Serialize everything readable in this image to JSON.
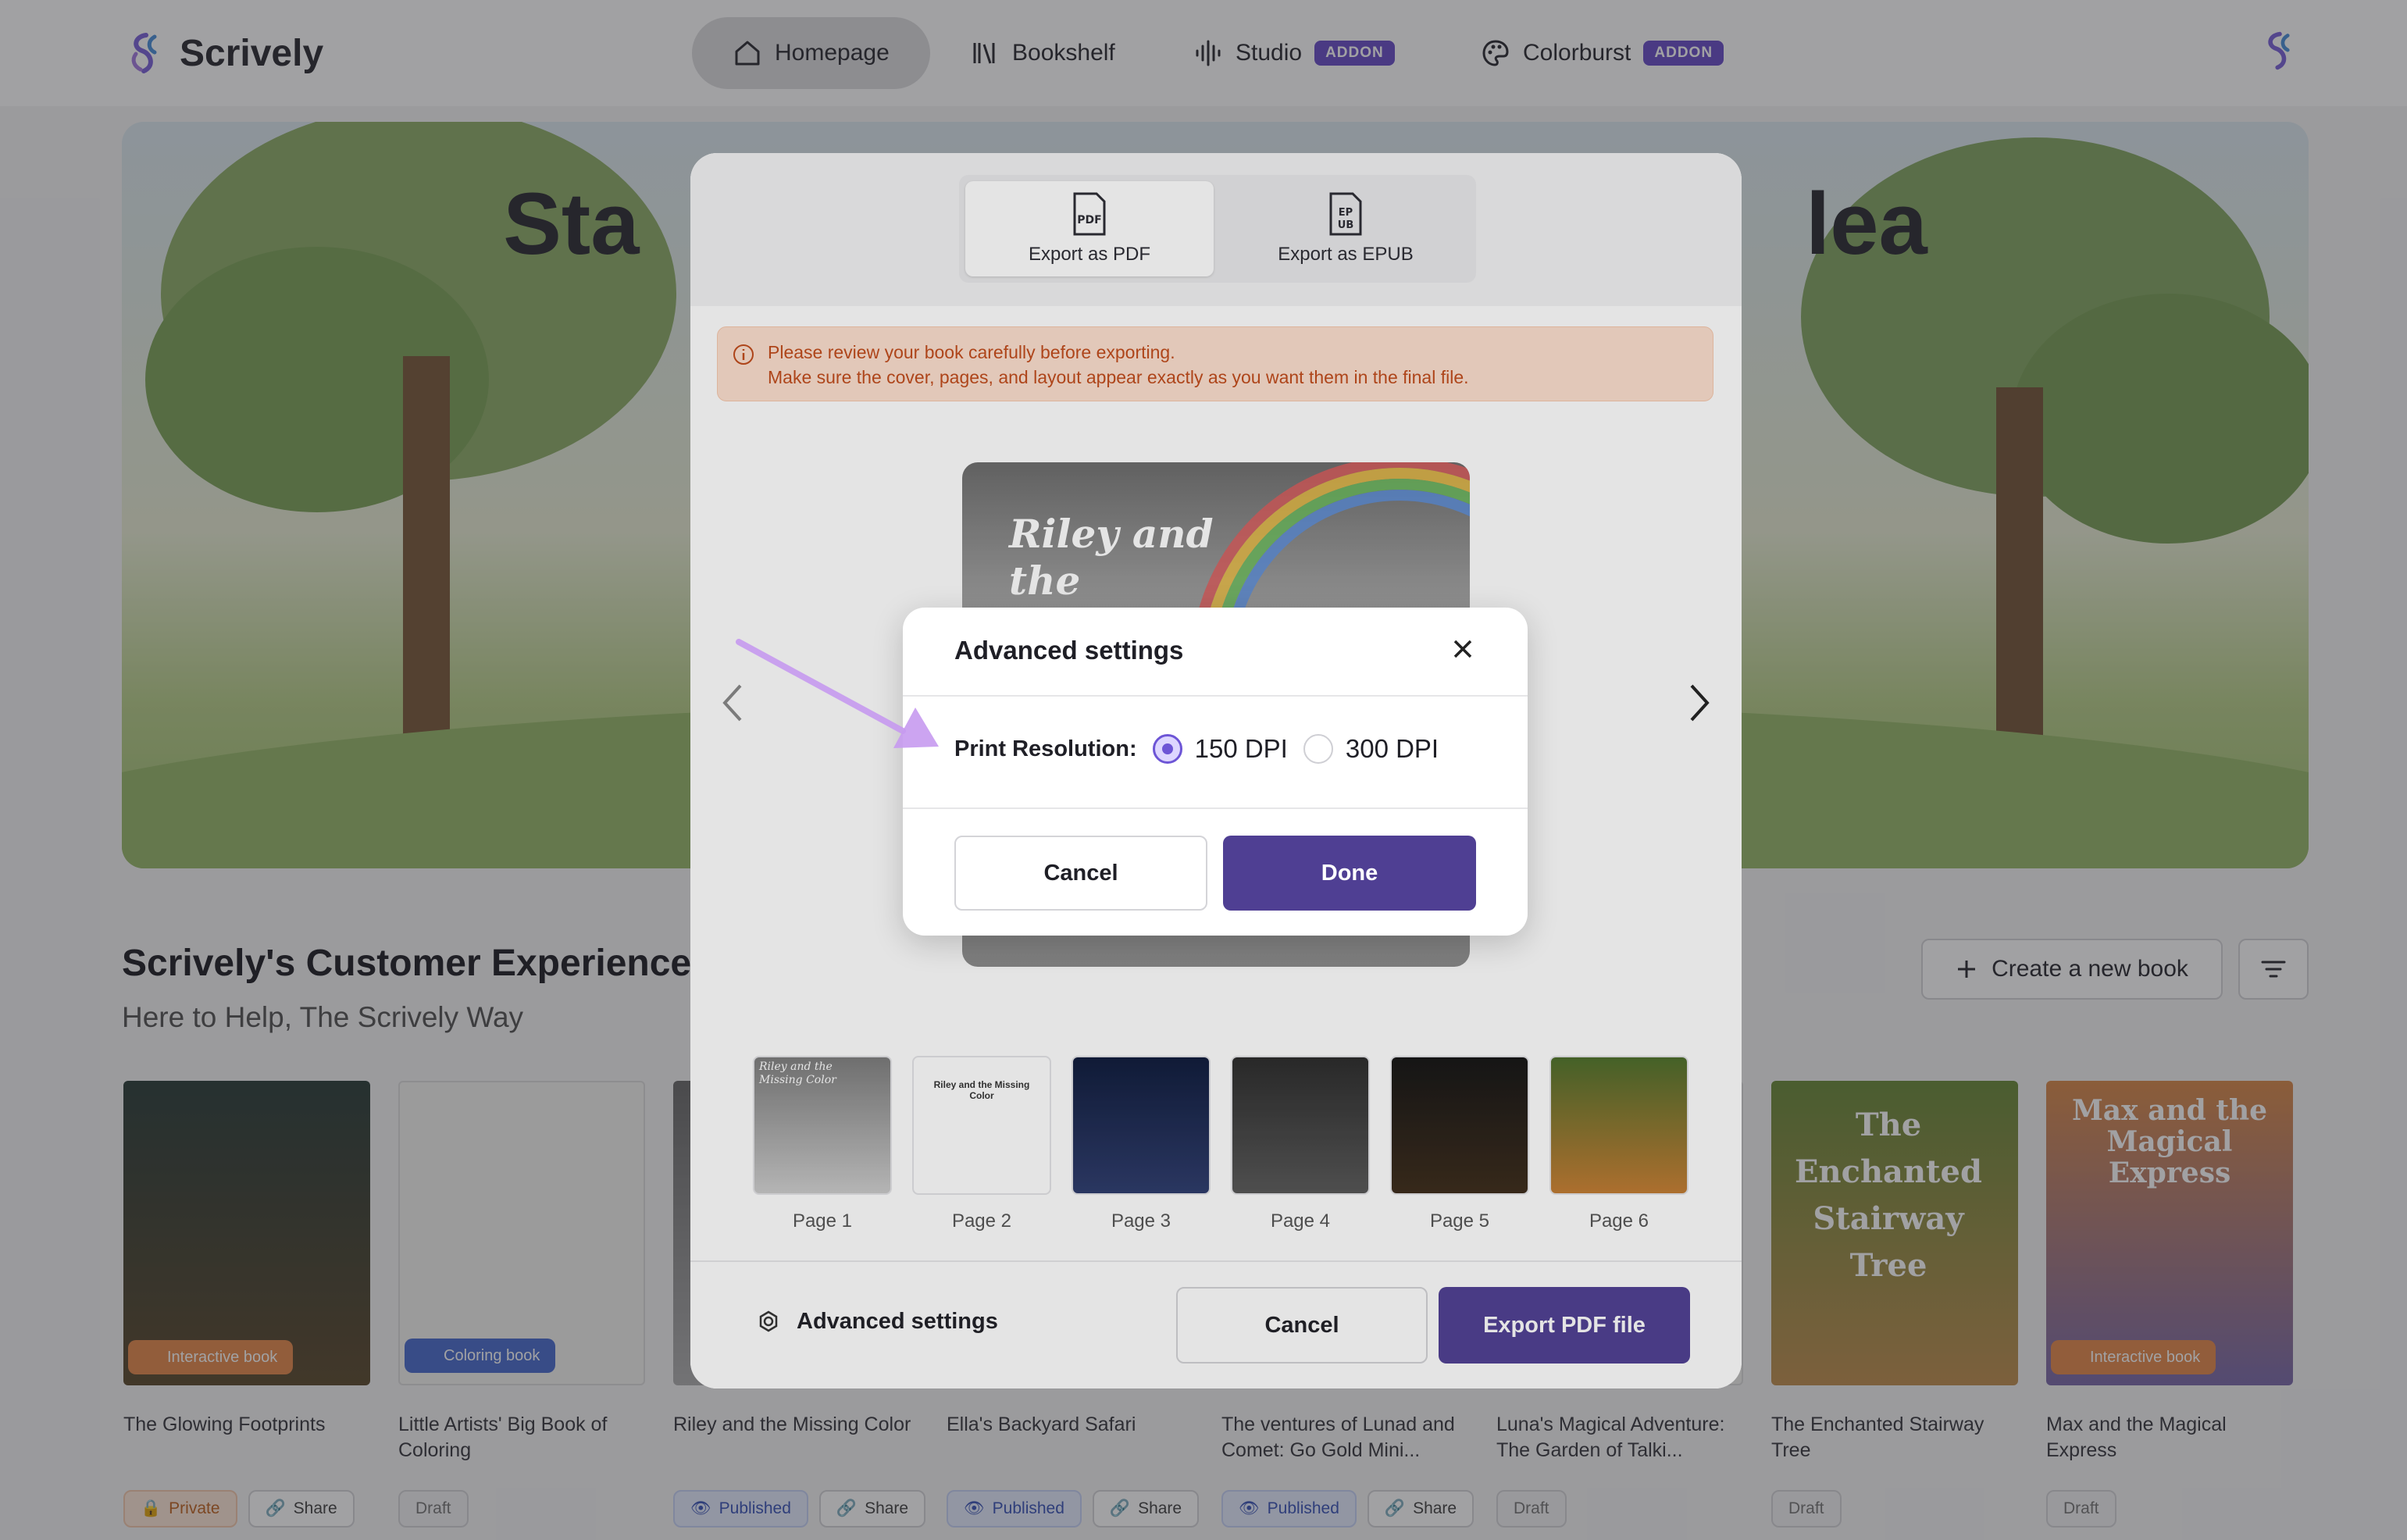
{
  "app": {
    "name": "Scrively"
  },
  "nav": {
    "items": [
      {
        "label": "Homepage",
        "icon": "home-icon"
      },
      {
        "label": "Bookshelf",
        "icon": "library-icon"
      },
      {
        "label": "Studio",
        "icon": "audio-wave-icon",
        "badge": "ADDON"
      },
      {
        "label": "Colorburst",
        "icon": "palette-icon",
        "badge": "ADDON"
      }
    ]
  },
  "hero": {
    "title": "Sta                                                lea"
  },
  "section": {
    "title": "Scrively's Customer Experience T",
    "subtitle": "Here to Help, The Scrively Way",
    "create_label": "Create a new book"
  },
  "books": [
    {
      "title": "The Glowing Footprints",
      "badge": "Interactive book",
      "status": "Private",
      "share": "Share"
    },
    {
      "title": "Little Artists' Big Book of Coloring",
      "badge": "Coloring book",
      "status": "Draft"
    },
    {
      "title": "Riley and the Missing Color",
      "status": "Published",
      "share": "Share"
    },
    {
      "title": "Ella's Backyard Safari",
      "status": "Published",
      "share": "Share"
    },
    {
      "title": "The ventures of Lunad and Comet: Go Gold Mini...",
      "status": "Published",
      "share": "Share"
    },
    {
      "title": "Luna's Magical Adventure: The Garden of Talki...",
      "status": "Draft"
    },
    {
      "title": "The Enchanted Stairway Tree",
      "status": "Draft"
    },
    {
      "title": "Max and the Magical Express",
      "badge": "Interactive book",
      "status": "Draft"
    }
  ],
  "export_modal": {
    "tabs": [
      {
        "label": "Export as PDF",
        "icon": "pdf-file-icon"
      },
      {
        "label": "Export as EPUB",
        "icon": "epub-file-icon"
      }
    ],
    "notice_line1": "Please review your book carefully before exporting.",
    "notice_line2": "Make sure the cover, pages, and layout appear exactly as you want them in the final file.",
    "preview_title": "Riley and the Missing",
    "thumbnails": [
      {
        "label": "Page 1",
        "caption": "Riley and the Missing Color"
      },
      {
        "label": "Page 2",
        "caption": "Riley and the Missing Color"
      },
      {
        "label": "Page 3"
      },
      {
        "label": "Page 4"
      },
      {
        "label": "Page 5"
      },
      {
        "label": "Page 6"
      }
    ],
    "advanced_settings_label": "Advanced settings",
    "cancel_label": "Cancel",
    "export_label": "Export PDF file"
  },
  "settings_dialog": {
    "title": "Advanced settings",
    "field_label": "Print Resolution:",
    "options": [
      "150 DPI",
      "300 DPI"
    ],
    "selected": "150 DPI",
    "cancel_label": "Cancel",
    "done_label": "Done"
  },
  "colors": {
    "primary": "#4f3f93",
    "accent": "#6a4fc9",
    "notice_text": "#c24a1a",
    "notice_bg": "#fde0cf"
  }
}
